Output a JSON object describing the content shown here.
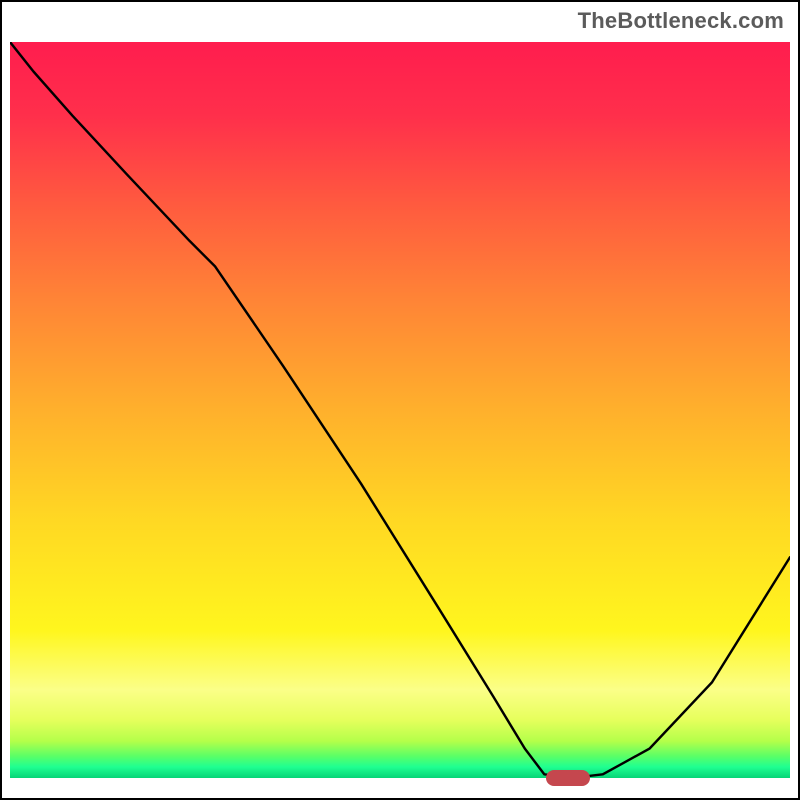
{
  "watermark": "TheBottleneck.com",
  "chart_data": {
    "type": "line",
    "title": "",
    "xlabel": "",
    "ylabel": "",
    "x": [
      0.0,
      0.03,
      0.08,
      0.15,
      0.23,
      0.263,
      0.35,
      0.45,
      0.55,
      0.62,
      0.66,
      0.685,
      0.72,
      0.76,
      0.82,
      0.9,
      1.0
    ],
    "y": [
      1.0,
      0.96,
      0.9,
      0.82,
      0.73,
      0.695,
      0.56,
      0.4,
      0.23,
      0.11,
      0.04,
      0.005,
      0.0,
      0.005,
      0.04,
      0.13,
      0.3
    ],
    "xlim": [
      0,
      1
    ],
    "ylim": [
      0,
      1
    ],
    "marker": {
      "x": 0.715,
      "y": 0.0
    },
    "background_gradient_stops": [
      {
        "pos": 0.0,
        "color": "#ff1d4e"
      },
      {
        "pos": 0.5,
        "color": "#ffb02c"
      },
      {
        "pos": 0.8,
        "color": "#fff61e"
      },
      {
        "pos": 1.0,
        "color": "#06d477"
      }
    ]
  }
}
